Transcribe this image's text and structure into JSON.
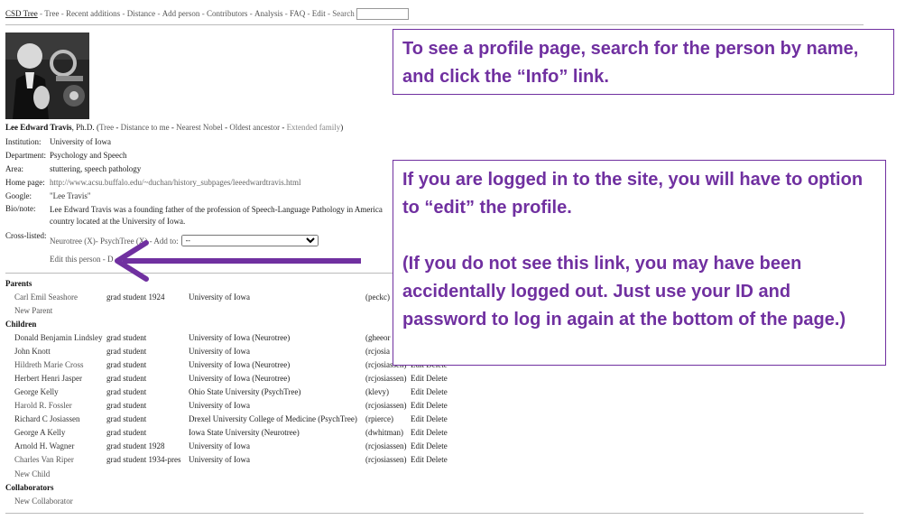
{
  "nav": {
    "home": "CSD Tree",
    "links": [
      "Tree",
      "Recent additions",
      "Distance",
      "Add person",
      "Contributors",
      "Analysis",
      "FAQ",
      "Edit",
      "Search"
    ]
  },
  "person": {
    "name": "Lee Edward Travis",
    "degree": ", Ph.D.",
    "links_open": " (",
    "links": [
      "Tree",
      "Distance to me",
      "Nearest Nobel",
      "Oldest ancestor",
      "Extended family"
    ],
    "links_close": ")",
    "fields": [
      {
        "label": "Institution:",
        "value": "University of Iowa"
      },
      {
        "label": "Department:",
        "value": "Psychology and Speech"
      },
      {
        "label": "Area:",
        "value": "stuttering, speech pathology"
      },
      {
        "label": "Home page:",
        "value": "http://www.acsu.buffalo.edu/~duchan/history_subpages/leeedwardtravis.html"
      },
      {
        "label": "Google:",
        "value": "\"Lee Travis\""
      }
    ],
    "bio_label": "Bio/note:",
    "bio": "Lee Edward Travis was a founding father of the profession of Speech-Language Pathology in America country located at the University of Iowa.",
    "crosslisted_label": "Cross-listed:",
    "crosslisted_value": "Neurotree (X)- PsychTree (X) - Add to:",
    "add_to_selected": "--",
    "edit_link": "Edit this person",
    "edit_suffix": " - D"
  },
  "relations": {
    "parents_title": "Parents",
    "parents": [
      {
        "name": "Carl Emil Seashore",
        "role": "grad student 1924",
        "inst": "University of Iowa",
        "user": "(peckc)",
        "actions": ""
      }
    ],
    "new_parent": "New Parent",
    "children_title": "Children",
    "children": [
      {
        "name": "Donald Benjamin Lindsley",
        "role": "grad student",
        "inst": "University of Iowa (Neurotree)",
        "user": "(gheeor",
        "actions": ""
      },
      {
        "name": "John Knott",
        "role": "grad student",
        "inst": "University of Iowa",
        "user": "(rcjosia",
        "actions": ""
      },
      {
        "name": "Hildreth Marie Cross",
        "role": "grad student",
        "inst": "University of Iowa (Neurotree)",
        "user": "(rcjosiassen)",
        "actions": "Edit Delete"
      },
      {
        "name": "Herbert Henri Jasper",
        "role": "grad student",
        "inst": "University of Iowa (Neurotree)",
        "user": "(rcjosiassen)",
        "actions": "Edit Delete"
      },
      {
        "name": "George Kelly",
        "role": "grad student",
        "inst": "Ohio State University (PsychTree)",
        "user": "(klevy)",
        "actions": "Edit Delete"
      },
      {
        "name": "Harold R. Fossler",
        "role": "grad student",
        "inst": "University of Iowa",
        "user": "(rcjosiassen)",
        "actions": "Edit Delete"
      },
      {
        "name": "Richard C Josiassen",
        "role": "grad student",
        "inst": "Drexel University College of Medicine (PsychTree)",
        "user": "(rpierce)",
        "actions": "Edit Delete"
      },
      {
        "name": "George A Kelly",
        "role": "grad student",
        "inst": "Iowa State University (Neurotree)",
        "user": "(dwhitman)",
        "actions": "Edit Delete"
      },
      {
        "name": "Arnold H. Wagner",
        "role": "grad student 1928",
        "inst": "University of Iowa",
        "user": "(rcjosiassen)",
        "actions": "Edit Delete"
      },
      {
        "name": "Charles Van Riper",
        "role": "grad student 1934-pres",
        "inst": "University of Iowa",
        "user": "(rcjosiassen)",
        "actions": "Edit Delete"
      }
    ],
    "new_child": "New Child",
    "collaborators_title": "Collaborators",
    "new_collaborator": "New Collaborator"
  },
  "callouts": {
    "top": "To see a profile page, search for the person by name, and click the “Info”  link.",
    "bottom_p1": "If you are logged in to the site, you will have to option to “edit” the profile.",
    "bottom_p2": "(If you do not see this link, you may have been accidentally logged out.  Just use your ID and password to log in again at the bottom of the page.)"
  },
  "colors": {
    "callout": "#7030a0",
    "arrow": "#7030a0"
  }
}
